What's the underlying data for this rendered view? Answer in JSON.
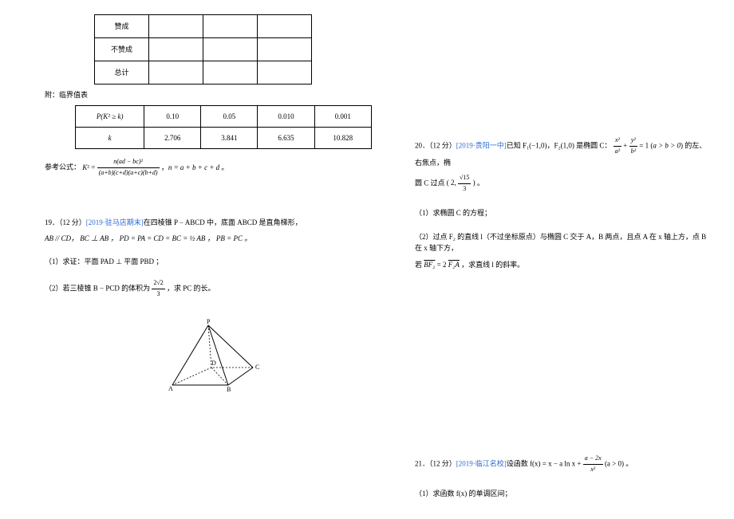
{
  "left": {
    "tbl1": {
      "rows": [
        "赞成",
        "不赞成",
        "总计"
      ]
    },
    "tbl1_caption": "附：临界值表",
    "tbl2": {
      "header_pk": "P(K² ≥ k)",
      "header_k": "k",
      "p": [
        "0.10",
        "0.05",
        "0.010",
        "0.001"
      ],
      "k": [
        "2.706",
        "3.841",
        "6.635",
        "10.828"
      ]
    },
    "formula_label": "参考公式：",
    "formula_body": "K² = n(ad − bc)² / [(a+b)(c+d)(a+c)(b+d)] ,  n = a + b + c + d 。",
    "q19": {
      "prefix": "19．（12 分）",
      "source": "[2019·驻马店期末]",
      "stem1": "在四棱锥 P − ABCD 中，底面 ABCD 是直角梯形，",
      "stem2": "AB // CD， BC ⊥ AB ， PD = PA = CD = BC = ½ AB ， PB = PC 。",
      "part1": "（1）求证：平面 PAD ⊥ 平面 PBD ；",
      "part2_a": "（2）若三棱锥 B − PCD 的体积为 ",
      "part2_b": " ，求 PC 的长。",
      "vol_num": "2√2",
      "vol_den": "3",
      "fig_labels": {
        "P": "P",
        "A": "A",
        "B": "B",
        "C": "C",
        "D": "D"
      }
    }
  },
  "right": {
    "q20": {
      "prefix": "20．（12 分）",
      "source": "[2019·贵阳一中]",
      "stem_a": "已知 F₁(−1,0)，F₂(1,0) 是椭圆 C：",
      "ellipse": "x²/a² + y²/b² = 1 (a > b > 0)",
      "stem_b": "的左、右焦点，椭",
      "stem_c": "圆 C 过点 ",
      "pt_x": "2,",
      "pt_y_num": "√15",
      "pt_y_den": "3",
      "stem_d": " 。",
      "part1": "（1）求椭圆 C 的方程；",
      "part2_a": "（2）过点 F₂ 的直线 l（不过坐标原点）与椭圆 C 交于 A，B 两点，且点 A 在 x 轴上方，点 B 在 x 轴下方，",
      "part2_b": "若 ",
      "vec1": "BF₂",
      "vec_eq": " = 2",
      "vec2": "F₂A",
      "part2_c": " ，求直线 l 的斜率。"
    },
    "q21": {
      "prefix": "21．（12 分）",
      "source": "[2019·临江名校]",
      "stem_a": "设函数 f(x) = x − a ln x + ",
      "fn_num": "a − 2x",
      "fn_den": "x²",
      "stem_b": " (a > 0) 。",
      "part1": "（1）求函数 f(x) 的单调区间；"
    }
  }
}
